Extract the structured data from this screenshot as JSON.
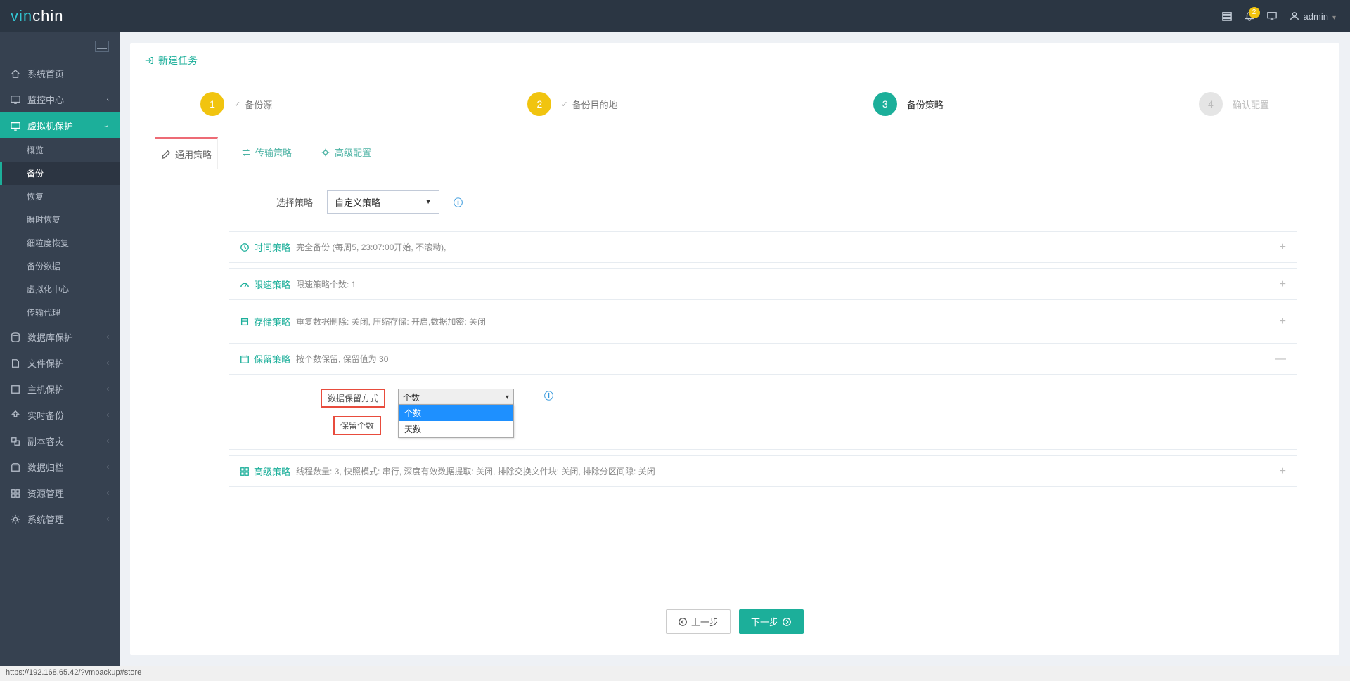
{
  "brand": {
    "part1": "vin",
    "part2": "chin"
  },
  "topbar": {
    "notif_count": "2",
    "user": "admin"
  },
  "sidebar": {
    "items": {
      "home": "系统首页",
      "monitor": "监控中心",
      "vmprotect": "虚拟机保护",
      "db": "数据库保护",
      "file": "文件保护",
      "host": "主机保护",
      "realtime": "实时备份",
      "replica": "副本容灾",
      "archive": "数据归档",
      "resource": "资源管理",
      "system": "系统管理"
    },
    "sub": {
      "overview": "概览",
      "backup": "备份",
      "restore": "恢复",
      "instant": "瞬时恢复",
      "granular": "细粒度恢复",
      "bdata": "备份数据",
      "vcenter": "虚拟化中心",
      "proxy": "传输代理"
    }
  },
  "page": {
    "title": "新建任务",
    "steps": {
      "s1": "备份源",
      "s2": "备份目的地",
      "s3": "备份策略",
      "s4": "确认配置",
      "n1": "1",
      "n2": "2",
      "n3": "3",
      "n4": "4"
    },
    "tabs": {
      "general": "通用策略",
      "transfer": "传输策略",
      "advanced": "高级配置"
    },
    "form": {
      "select_policy_label": "选择策略",
      "select_policy_value": "自定义策略"
    },
    "accordion": {
      "time": {
        "title": "时间策略",
        "desc": "完全备份 (每周5, 23:07:00开始, 不滚动),"
      },
      "speed": {
        "title": "限速策略",
        "desc": "限速策略个数: 1"
      },
      "storage": {
        "title": "存储策略",
        "desc": "重复数据删除: 关闭, 压缩存储: 开启,数据加密: 关闭"
      },
      "retain": {
        "title": "保留策略",
        "desc": "按个数保留, 保留值为 30"
      },
      "adv": {
        "title": "高级策略",
        "desc": "线程数量: 3, 快照模式: 串行, 深度有效数据提取: 关闭, 排除交换文件块: 关闭, 排除分区间隙: 关闭"
      }
    },
    "retain_form": {
      "mode_label": "数据保留方式",
      "count_label": "保留个数",
      "select_value": "个数",
      "opt1": "个数",
      "opt2": "天数"
    },
    "buttons": {
      "prev": "上一步",
      "next": "下一步"
    }
  },
  "status_url": "https://192.168.65.42/?vmbackup#store"
}
